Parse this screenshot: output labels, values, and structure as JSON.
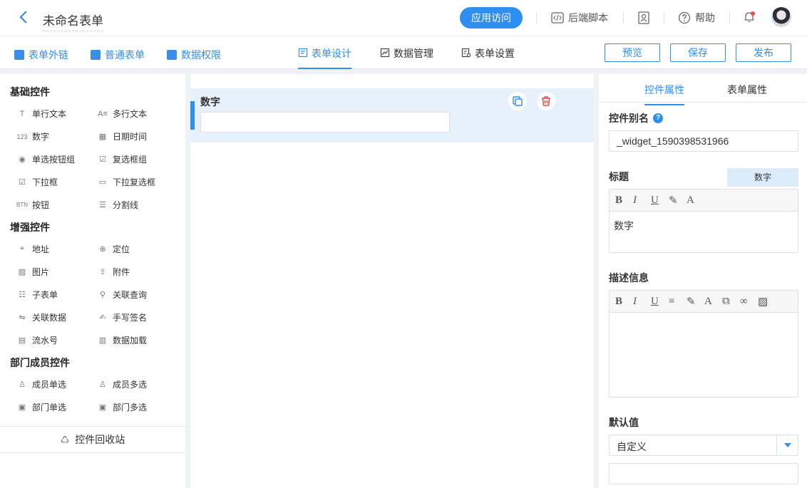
{
  "topbar": {
    "title": "未命名表单",
    "app_visit": "应用访问",
    "backend_script": "后端脚本",
    "help": "帮助"
  },
  "subbar": {
    "links": [
      "表单外链",
      "普通表单",
      "数据权限"
    ],
    "tabs": [
      "表单设计",
      "数据管理",
      "表单设置"
    ],
    "active_tab": "表单设计",
    "buttons": {
      "preview": "预览",
      "save": "保存",
      "publish": "发布"
    }
  },
  "left_panel": {
    "sections": [
      {
        "title": "基础控件",
        "items": [
          "单行文本",
          "多行文本",
          "数字",
          "日期时间",
          "单选按钮组",
          "复选框组",
          "下拉框",
          "下拉复选框",
          "按钮",
          "分割线"
        ]
      },
      {
        "title": "增强控件",
        "items": [
          "地址",
          "定位",
          "图片",
          "附件",
          "子表单",
          "关联查询",
          "关联数据",
          "手写签名",
          "流水号",
          "数据加载"
        ]
      },
      {
        "title": "部门成员控件",
        "items": [
          "成员单选",
          "成员多选",
          "部门单选",
          "部门多选"
        ]
      }
    ],
    "recycle_bin": "控件回收站"
  },
  "canvas": {
    "field_label": "数字",
    "field_value": ""
  },
  "right_panel": {
    "tabs": [
      "控件属性",
      "表单属性"
    ],
    "active_tab": "控件属性",
    "alias_label": "控件别名",
    "alias_value": "_widget_1590398531966",
    "title_label": "标题",
    "title_chip": "数字",
    "title_content": "数字",
    "desc_label": "描述信息",
    "desc_content": "",
    "default_label": "默认值",
    "default_value": "自定义",
    "default_input": ""
  },
  "colors": {
    "accent": "#2e8ff0",
    "selected_row": "#e6f1fc",
    "delete": "#e5484d",
    "page_bg": "#f0f2f5"
  },
  "icons": {
    "back": "chevron-left-icon",
    "code": "code-icon",
    "user-card": "user-card-icon",
    "help": "question-circle-icon",
    "bell": "bell-icon",
    "copy": "copy-icon",
    "delete": "trash-icon",
    "recycle": "recycle-icon"
  }
}
